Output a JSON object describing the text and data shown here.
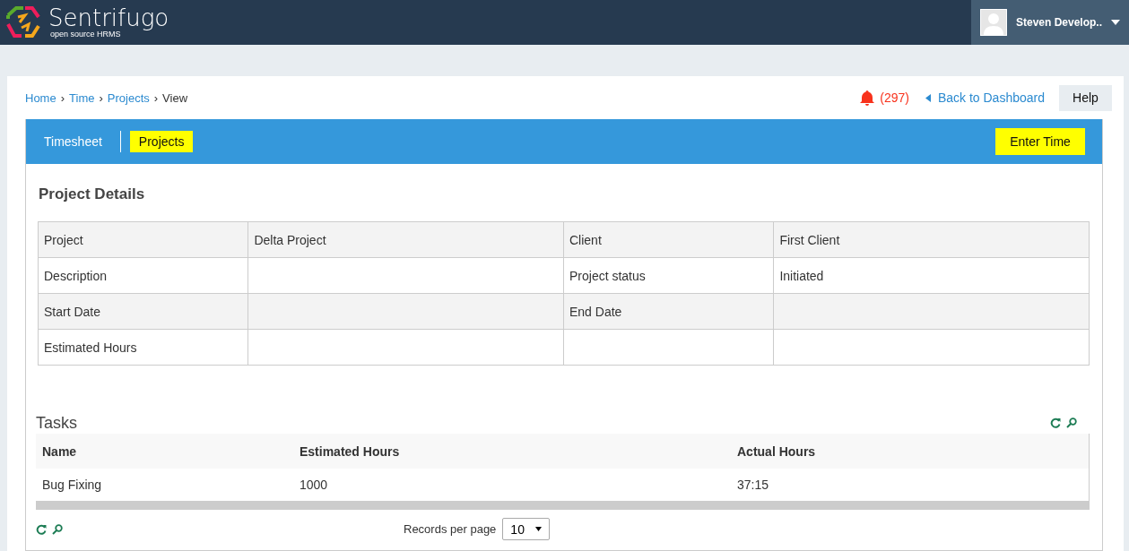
{
  "header": {
    "brand": "Sentrifugo",
    "tagline": "open source HRMS",
    "user": "Steven Develop.."
  },
  "breadcrumb": [
    {
      "label": "Home",
      "link": true
    },
    {
      "label": "Time",
      "link": true
    },
    {
      "label": "Projects",
      "link": true
    },
    {
      "label": "View",
      "link": false
    }
  ],
  "separator": "›",
  "notifications": "(297)",
  "back_link": "Back to Dashboard",
  "help": "Help",
  "tabs": [
    {
      "label": "Timesheet",
      "selected": false
    },
    {
      "label": "Projects",
      "selected": true
    }
  ],
  "enter_time": "Enter Time",
  "details": {
    "title": "Project Details",
    "rows": [
      [
        "Project",
        "Delta Project",
        "Client",
        "First Client"
      ],
      [
        "Description",
        "",
        "Project status",
        "Initiated"
      ],
      [
        "Start Date",
        "",
        "End Date",
        ""
      ],
      [
        "Estimated Hours",
        "",
        "",
        ""
      ]
    ]
  },
  "tasks": {
    "title": "Tasks",
    "columns": [
      "Name",
      "Estimated Hours",
      "Actual Hours"
    ],
    "rows": [
      [
        "Bug Fixing",
        "1000",
        "37:15"
      ]
    ]
  },
  "records_per_page": {
    "label": "Records per page",
    "value": "10"
  }
}
